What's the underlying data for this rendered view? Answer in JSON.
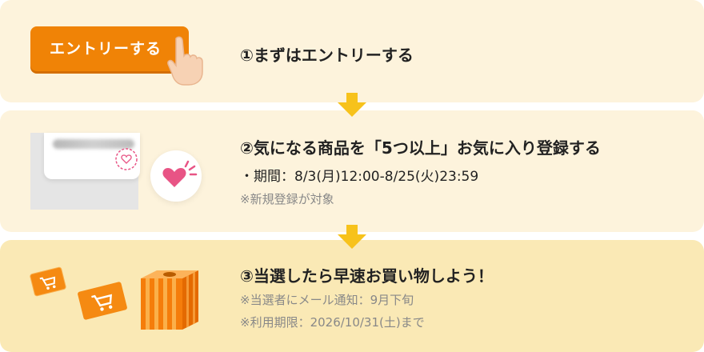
{
  "step1": {
    "entry_button_label": "エントリーする",
    "title": "①まずはエントリーする"
  },
  "step2": {
    "title": "②気になる商品を「5つ以上」お気に入り登録する",
    "period": "・期間：8/3(月)12:00-8/25(火)23:59",
    "note": "※新規登録が対象"
  },
  "step3": {
    "title": "③当選したら早速お買い物しよう！",
    "note_notification": "※当選者にメール通知：9月下旬",
    "note_expiry": "※利用期限：2026/10/31(土)まで"
  },
  "icons": [
    "pointing-hand-icon",
    "arrow-down-icon",
    "heart-icon",
    "heart-outline-icon",
    "shopping-cart-icon",
    "lottery-box-icon"
  ],
  "colors": {
    "panel": "#fdf3dc",
    "panel_step3": "#fae9b5",
    "entry_button": "#f08306",
    "arrow": "#f7c21b",
    "heart": "#e85485",
    "ticket": "#f58a12"
  }
}
